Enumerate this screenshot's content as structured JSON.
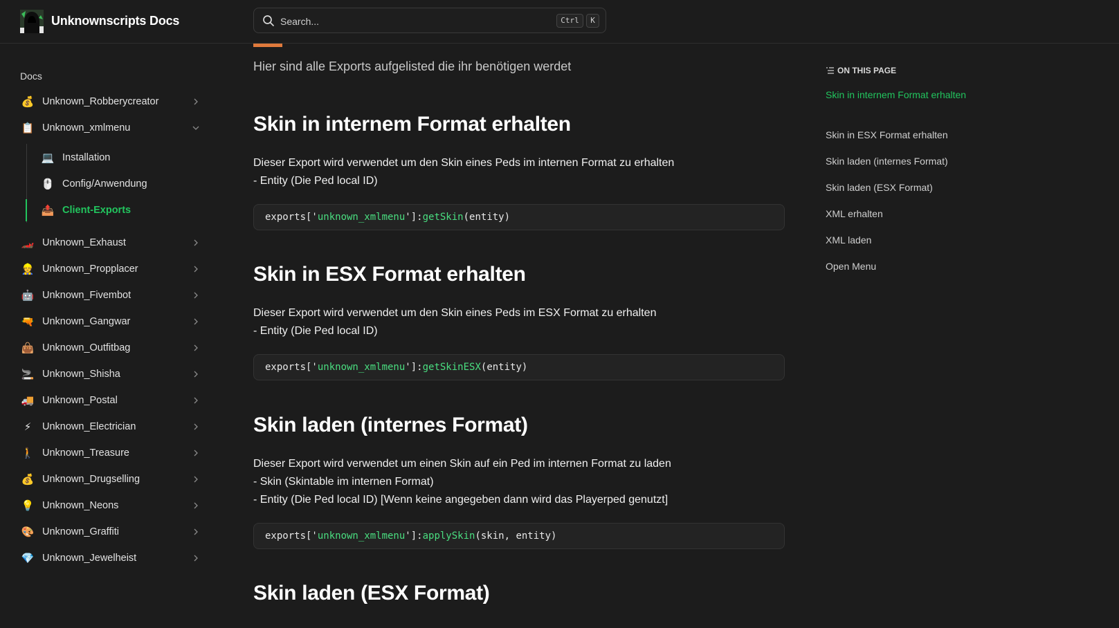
{
  "header": {
    "site_title": "Unknownscripts Docs",
    "logo_icon": "hooded-figure-logo",
    "search": {
      "placeholder": "Search...",
      "shortcut_ctrl": "Ctrl",
      "shortcut_key": "K"
    }
  },
  "sidebar": {
    "heading": "Docs",
    "items": [
      {
        "label": "Unknown_Robberycreator",
        "icon": "💰"
      },
      {
        "label": "Unknown_xmlmenu",
        "icon": "📋",
        "expanded": true
      },
      {
        "label": "Unknown_Exhaust",
        "icon": "🏎️"
      },
      {
        "label": "Unknown_Propplacer",
        "icon": "👷"
      },
      {
        "label": "Unknown_Fivembot",
        "icon": "🤖"
      },
      {
        "label": "Unknown_Gangwar",
        "icon": "🔫"
      },
      {
        "label": "Unknown_Outfitbag",
        "icon": "👜"
      },
      {
        "label": "Unknown_Shisha",
        "icon": "🚬"
      },
      {
        "label": "Unknown_Postal",
        "icon": "🚚"
      },
      {
        "label": "Unknown_Electrician",
        "icon": "⚡"
      },
      {
        "label": "Unknown_Treasure",
        "icon": "🚶"
      },
      {
        "label": "Unknown_Drugselling",
        "icon": "💰"
      },
      {
        "label": "Unknown_Neons",
        "icon": "💡"
      },
      {
        "label": "Unknown_Graffiti",
        "icon": "🎨"
      },
      {
        "label": "Unknown_Jewelheist",
        "icon": "💎"
      }
    ],
    "subitems": [
      {
        "label": "Installation",
        "icon": "💻"
      },
      {
        "label": "Config/Anwendung",
        "icon": "🖱️"
      },
      {
        "label": "Client-Exports",
        "icon": "📤",
        "active": true
      }
    ]
  },
  "main": {
    "lead": "Hier sind alle Exports aufgelisted die ihr benötigen werdet",
    "sections": [
      {
        "title": "Skin in internem Format erhalten",
        "lines": [
          "Dieser Export wird verwendet um den Skin eines Peds im internen Format zu erhalten",
          "- Entity (Die Ped local ID)"
        ],
        "code": {
          "prefix": "exports['",
          "resource": "unknown_xmlmenu",
          "mid": "']:",
          "fn": "getSkin",
          "args": "(entity)"
        }
      },
      {
        "title": "Skin in ESX Format erhalten",
        "lines": [
          "Dieser Export wird verwendet um den Skin eines Peds im ESX Format zu erhalten",
          "- Entity (Die Ped local ID)"
        ],
        "code": {
          "prefix": "exports['",
          "resource": "unknown_xmlmenu",
          "mid": "']:",
          "fn": "getSkinESX",
          "args": "(entity)"
        }
      },
      {
        "title": "Skin laden (internes Format)",
        "lines": [
          "Dieser Export wird verwendet um einen Skin auf ein Ped im internen Format zu laden",
          "- Skin (Skintable im internen Format)",
          "- Entity (Die Ped local ID) [Wenn keine angegeben dann wird das Playerped genutzt]"
        ],
        "code": {
          "prefix": "exports['",
          "resource": "unknown_xmlmenu",
          "mid": "']:",
          "fn": "applySkin",
          "args": "(skin, entity)"
        }
      },
      {
        "title": "Skin laden (ESX Format)"
      }
    ]
  },
  "toc": {
    "heading": "ON THIS PAGE",
    "links": [
      {
        "label": "Skin in internem Format erhalten",
        "active": true
      },
      {
        "label": "Skin in ESX Format erhalten"
      },
      {
        "label": "Skin laden (internes Format)"
      },
      {
        "label": "Skin laden (ESX Format)"
      },
      {
        "label": "XML erhalten"
      },
      {
        "label": "XML laden"
      },
      {
        "label": "Open Menu"
      }
    ]
  },
  "colors": {
    "background": "#1c1c1c",
    "accent": "#22c55e",
    "code_string": "#4ade80"
  }
}
